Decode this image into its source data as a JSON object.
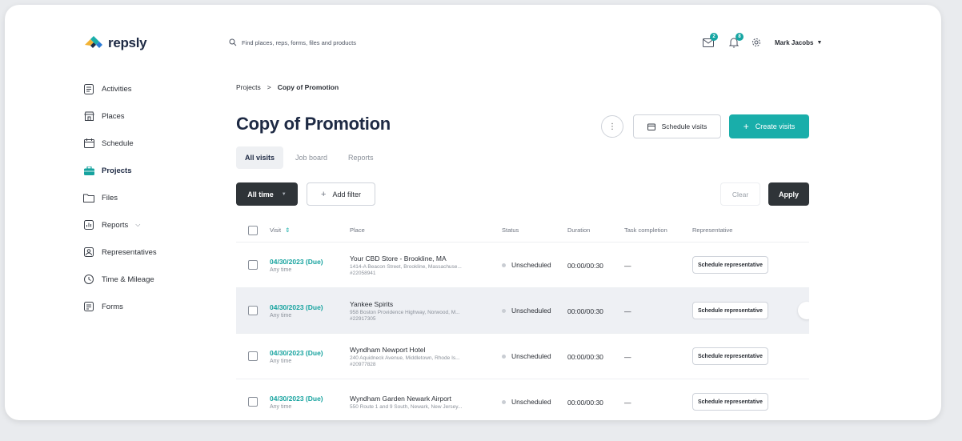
{
  "brand": {
    "name": "repsly",
    "accent": "#19aeaa"
  },
  "search": {
    "placeholder": "Find places, reps, forms, files and products",
    "icon": "search-icon"
  },
  "header": {
    "messages_badge": "2",
    "notifications_badge": "8",
    "user_name": "Mark Jacobs"
  },
  "sidebar": {
    "items": [
      {
        "label": "Activities",
        "icon": "activities-icon"
      },
      {
        "label": "Places",
        "icon": "store-icon"
      },
      {
        "label": "Schedule",
        "icon": "calendar-icon"
      },
      {
        "label": "Projects",
        "icon": "briefcase-icon"
      },
      {
        "label": "Files",
        "icon": "folder-icon"
      },
      {
        "label": "Reports",
        "icon": "chart-icon"
      },
      {
        "label": "Representatives",
        "icon": "person-icon"
      },
      {
        "label": "Time & Mileage",
        "icon": "clock-icon"
      },
      {
        "label": "Forms",
        "icon": "form-icon"
      }
    ]
  },
  "breadcrumb": {
    "parent": "Projects",
    "separator": ">",
    "current": "Copy of Promotion"
  },
  "page": {
    "title": "Copy of Promotion"
  },
  "actions": {
    "schedule_visits": "Schedule visits",
    "create_visits": "Create visits"
  },
  "tabs": [
    {
      "label": "All visits"
    },
    {
      "label": "Job board"
    },
    {
      "label": "Reports"
    }
  ],
  "filters": {
    "time": "All time",
    "add_filter": "Add filter",
    "clear": "Clear",
    "apply": "Apply"
  },
  "table": {
    "headers": {
      "visit": "Visit",
      "place": "Place",
      "status": "Status",
      "duration": "Duration",
      "task": "Task completion",
      "rep": "Representative"
    },
    "rows": [
      {
        "date": "04/30/2023 (Due)",
        "time": "Any time",
        "place": "Your CBD Store - Brookline, MA",
        "address": "1414-A Beacon Street, Brookline, Massachuse...",
        "id": "#22058941",
        "status": "Unscheduled",
        "duration": "00:00/00:30",
        "task": "—",
        "rep": "Schedule representative"
      },
      {
        "date": "04/30/2023 (Due)",
        "time": "Any time",
        "place": "Yankee Spirits",
        "address": "958 Boston Providence Highway, Norwood, M...",
        "id": "#22917305",
        "status": "Unscheduled",
        "duration": "00:00/00:30",
        "task": "—",
        "rep": "Schedule representative"
      },
      {
        "date": "04/30/2023 (Due)",
        "time": "Any time",
        "place": "Wyndham Newport Hotel",
        "address": "240 Aquidneck Avenue, Middletown, Rhode Is...",
        "id": "#20977828",
        "status": "Unscheduled",
        "duration": "00:00/00:30",
        "task": "—",
        "rep": "Schedule representative"
      },
      {
        "date": "04/30/2023 (Due)",
        "time": "Any time",
        "place": "Wyndham Garden Newark Airport",
        "address": "550 Route 1 and 9 South, Newark, New Jersey...",
        "id": "",
        "status": "Unscheduled",
        "duration": "00:00/00:30",
        "task": "—",
        "rep": "Schedule representative"
      }
    ]
  }
}
